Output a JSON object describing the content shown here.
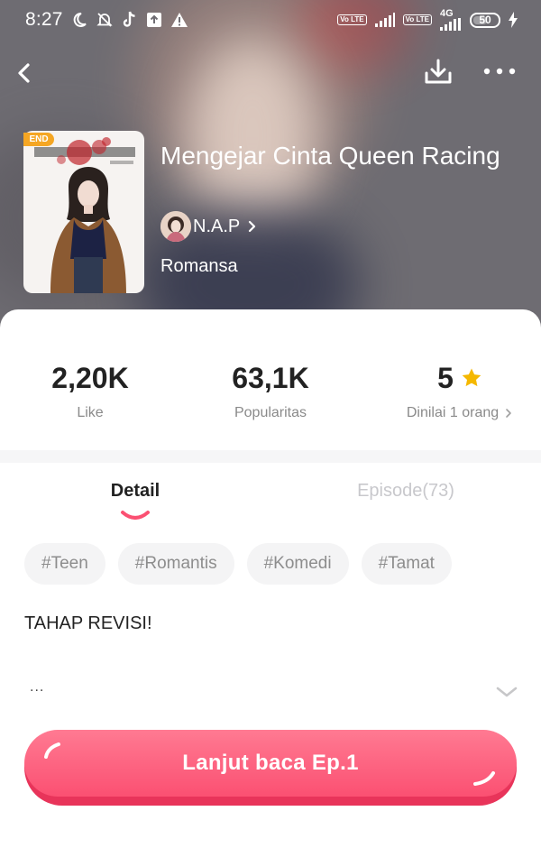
{
  "status_bar": {
    "time": "8:27",
    "battery": "50",
    "network": "4G",
    "volte": "Vo LTE"
  },
  "book": {
    "end_badge": "END",
    "title": "Mengejar Cinta Queen Racing",
    "author": "N.A.P",
    "genre": "Romansa"
  },
  "stats": {
    "like": {
      "value": "2,20K",
      "label": "Like"
    },
    "popularity": {
      "value": "63,1K",
      "label": "Popularitas"
    },
    "rating": {
      "value": "5",
      "label": "Dinilai 1 orang"
    }
  },
  "tabs": [
    {
      "label": "Detail",
      "active": true
    },
    {
      "label": "Episode(73)",
      "active": false
    }
  ],
  "tags": [
    "#Teen",
    "#Romantis",
    "#Komedi",
    "#Tamat"
  ],
  "synopsis": {
    "text": "TAHAP REVISI!",
    "ellipsis": "..."
  },
  "cta": {
    "label": "Lanjut baca Ep.1"
  },
  "colors": {
    "accent": "#fb5072",
    "star": "#f5b800",
    "end_badge": "#f5a623"
  }
}
